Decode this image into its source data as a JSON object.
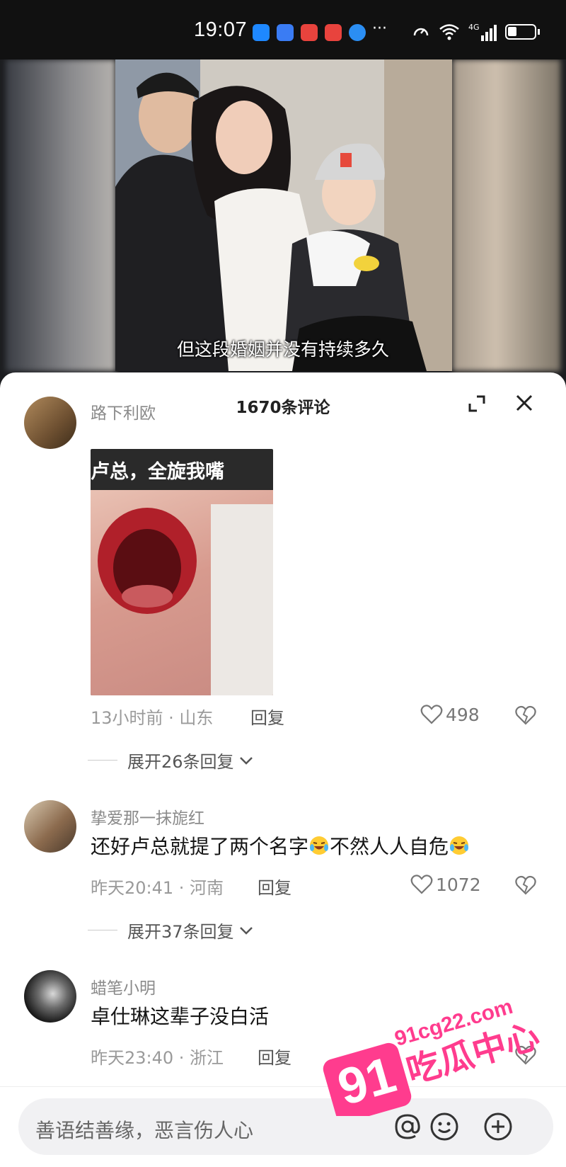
{
  "status_bar": {
    "time": "19:07",
    "more": "···",
    "network": "4G",
    "app_icons": [
      "message-app-icon",
      "signal-app-icon",
      "shop-app-icon",
      "shop-app-icon",
      "browser-app-icon"
    ]
  },
  "video": {
    "subtitle": "但这段婚姻并没有持续多久"
  },
  "comments_panel": {
    "title": "1670条评论",
    "comments": [
      {
        "username": "路下利欧",
        "image_caption": "卢总，全旋我嘴",
        "time_location": "13小时前 · 山东",
        "reply_label": "回复",
        "likes": "498",
        "expand_label": "展开26条回复"
      },
      {
        "username": "挚爱那一抹旎红",
        "text_part1": "还好卢总就提了两个名字",
        "text_part2": "不然人人自危",
        "time_location": "昨天20:41 · 河南",
        "reply_label": "回复",
        "likes": "1072",
        "expand_label": "展开37条回复"
      },
      {
        "username": "蜡笔小明",
        "text": "卓仕琳这辈子没白活",
        "time_location": "昨天23:40 · 浙江",
        "reply_label": "回复"
      }
    ]
  },
  "input_bar": {
    "placeholder": "善语结善缘，恶言伤人心"
  },
  "watermark": {
    "number": "91",
    "domain": "91cg22.com",
    "text": "吃瓜中心"
  },
  "colors": {
    "watermark_pink": "#ff3c8e",
    "text_dark": "#161616",
    "text_gray": "#9a9a9a"
  }
}
